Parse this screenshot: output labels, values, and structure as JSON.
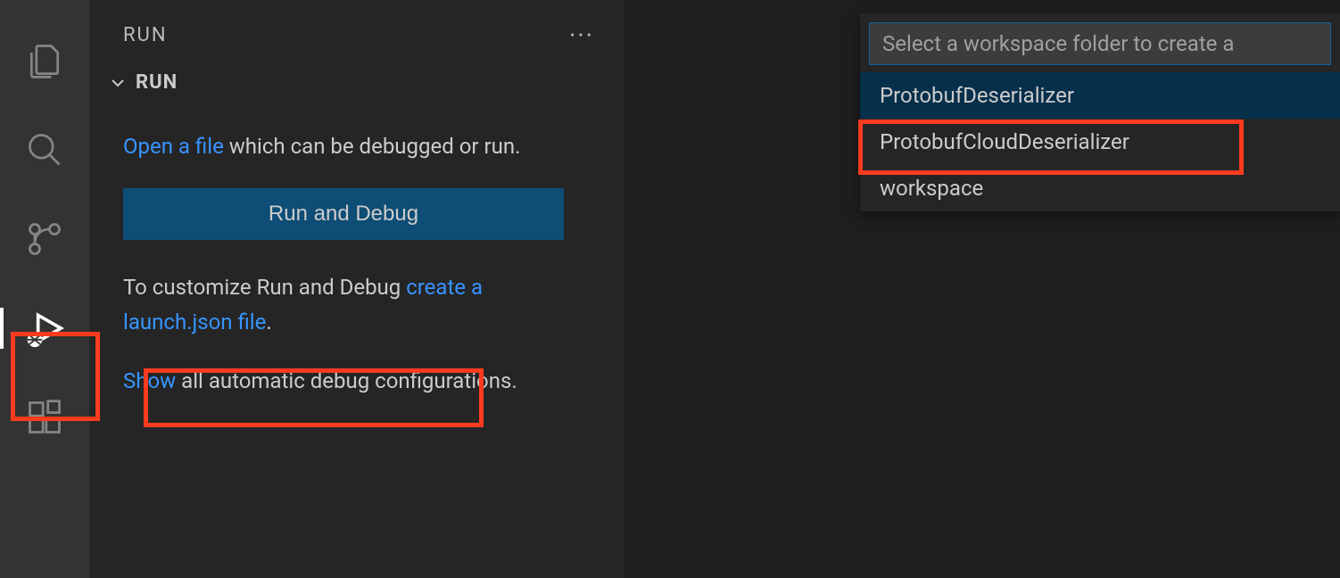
{
  "activityBar": {
    "items": [
      {
        "name": "explorer"
      },
      {
        "name": "search"
      },
      {
        "name": "source-control"
      },
      {
        "name": "run-debug",
        "active": true
      },
      {
        "name": "extensions"
      }
    ]
  },
  "sidebar": {
    "title": "RUN",
    "sectionTitle": "RUN",
    "openFileLink": "Open a file",
    "openFileText": " which can be debugged or run.",
    "runDebugButton": "Run and Debug",
    "customizeText": "To customize Run and Debug ",
    "createLaunchLink": "create a launch.json file",
    "customizeEnd": ".",
    "showLink": "Show",
    "showText": " all automatic debug configurations."
  },
  "quickpick": {
    "placeholder": "Select a workspace folder to create a",
    "items": [
      {
        "label": "ProtobufDeserializer",
        "selected": true
      },
      {
        "label": "ProtobufCloudDeserializer",
        "selected": false
      },
      {
        "label": "workspace",
        "selected": false
      }
    ]
  }
}
